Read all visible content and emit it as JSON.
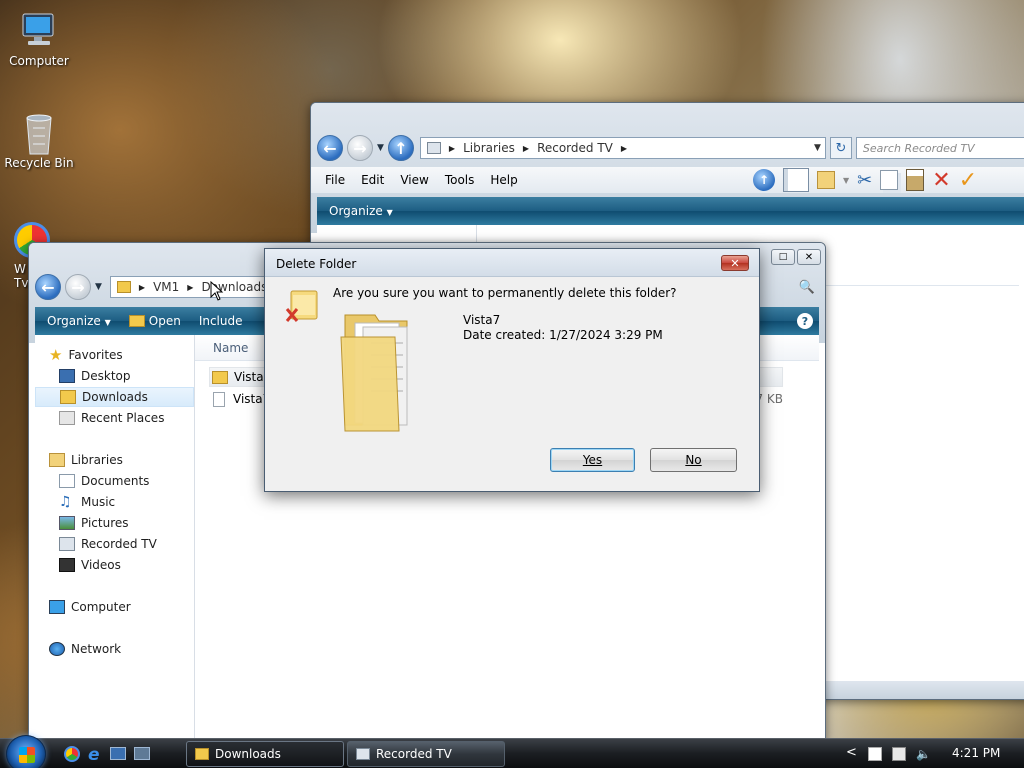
{
  "desktop": {
    "icons": [
      {
        "label": "Computer"
      },
      {
        "label": "Recycle Bin"
      },
      {
        "label": "W\nTv"
      }
    ]
  },
  "recorded_tv_window": {
    "address": {
      "parts": [
        "Libraries",
        "Recorded TV"
      ]
    },
    "search_placeholder": "Search Recorded TV",
    "menu": [
      "File",
      "Edit",
      "View",
      "Tools",
      "Help"
    ],
    "organize_label": "Organize"
  },
  "downloads_window": {
    "address": {
      "parts": [
        "VM1",
        "Downloads"
      ]
    },
    "toolbar": {
      "organize": "Organize",
      "open": "Open",
      "include": "Include"
    },
    "column_header_name": "Name",
    "files": [
      {
        "name": "Vista7",
        "type": "folder"
      },
      {
        "name": "Vista7",
        "type": "file",
        "size_partial": "7 KB"
      }
    ],
    "nav": {
      "favorites": "Favorites",
      "desktop": "Desktop",
      "downloads": "Downloads",
      "recent_places": "Recent Places",
      "libraries": "Libraries",
      "documents": "Documents",
      "music": "Music",
      "pictures": "Pictures",
      "recorded_tv": "Recorded TV",
      "videos": "Videos",
      "computer": "Computer",
      "network": "Network"
    }
  },
  "dialog": {
    "title": "Delete Folder",
    "question": "Are you sure you want to permanently delete this folder?",
    "item_name": "Vista7",
    "date_created": "Date created: 1/27/2024 3:29 PM",
    "yes_label": "Yes",
    "no_label": "No"
  },
  "taskbar": {
    "buttons": [
      {
        "label": "Downloads",
        "active": true
      },
      {
        "label": "Recorded TV",
        "active": false
      }
    ],
    "clock": "4:21 PM",
    "tray_expand": "<"
  },
  "colors": {
    "accent": "#1d5d82",
    "taskbar": "#1b1e22",
    "close_red": "#c9463d"
  }
}
